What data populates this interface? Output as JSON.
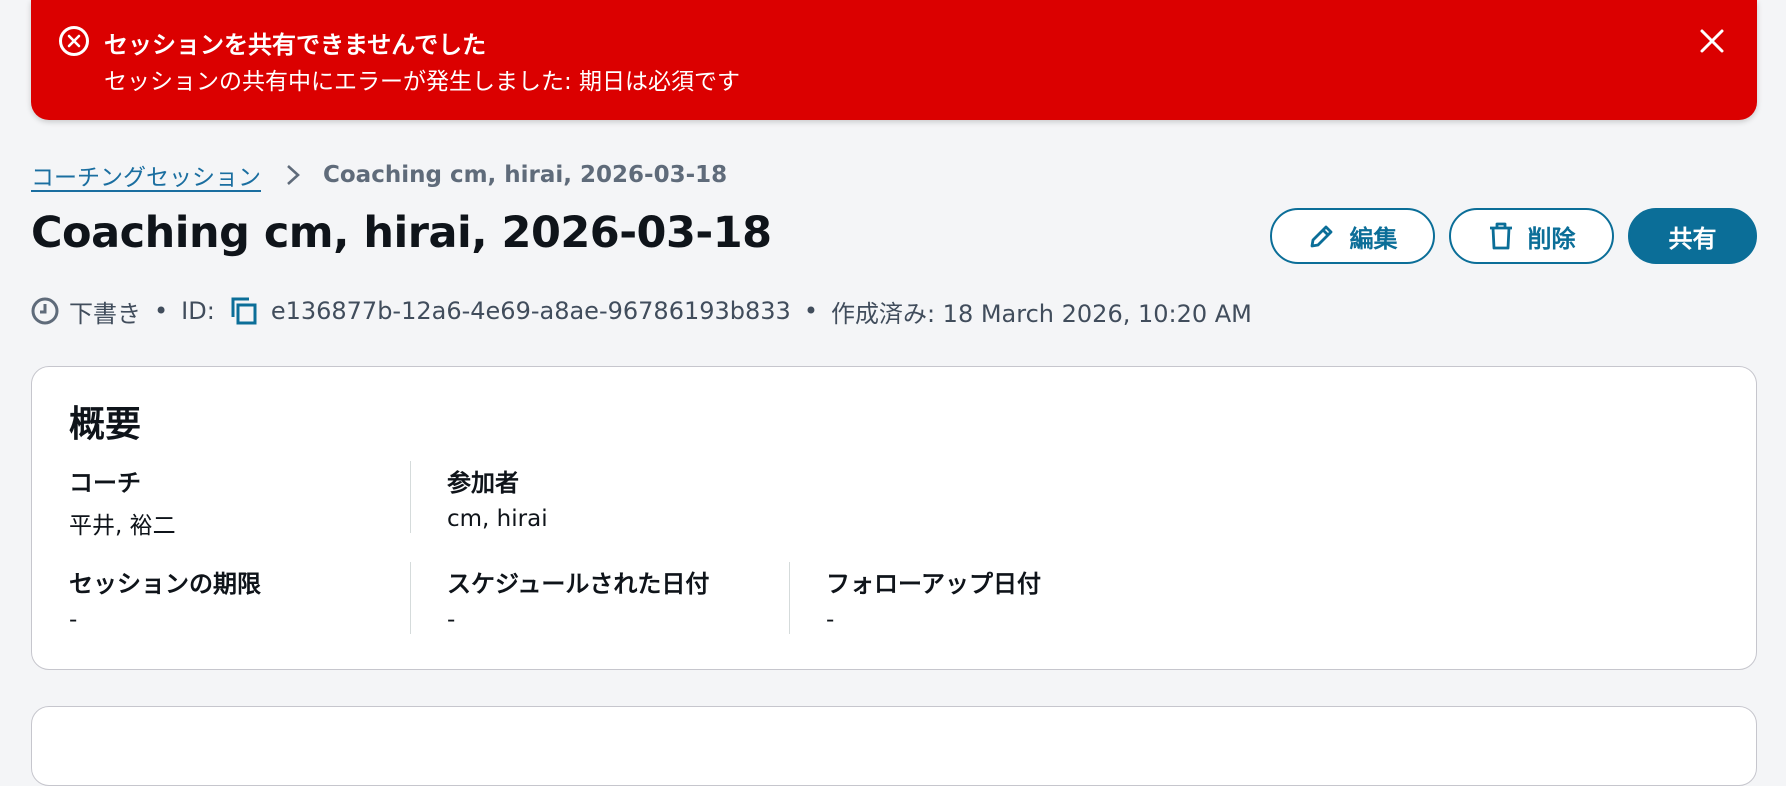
{
  "flash": {
    "title": "セッションを共有できませんでした",
    "message": "セッションの共有中にエラーが発生しました: 期日は必須です",
    "color": "#db0000"
  },
  "breadcrumb": {
    "parent": "コーチングセッション",
    "current": "Coaching cm, hirai, 2026-03-18"
  },
  "page_title": "Coaching cm, hirai, 2026-03-18",
  "actions": {
    "edit_label": "編集",
    "delete_label": "削除",
    "share_label": "共有",
    "accent": "#0b6e98"
  },
  "meta": {
    "status": "下書き",
    "id_label": "ID:",
    "id_value": "e136877b-12a6-4e69-a8ae-96786193b833",
    "created": "作成済み: 18 March 2026, 10:20 AM",
    "separator": "•"
  },
  "overview": {
    "title": "概要",
    "fields": [
      {
        "label": "コーチ",
        "value": "平井, 裕二"
      },
      {
        "label": "参加者",
        "value": "cm, hirai"
      },
      {
        "label": "セッションの期限",
        "value": "-"
      },
      {
        "label": "スケジュールされた日付",
        "value": "-"
      },
      {
        "label": "フォローアップ日付",
        "value": "-"
      }
    ]
  }
}
